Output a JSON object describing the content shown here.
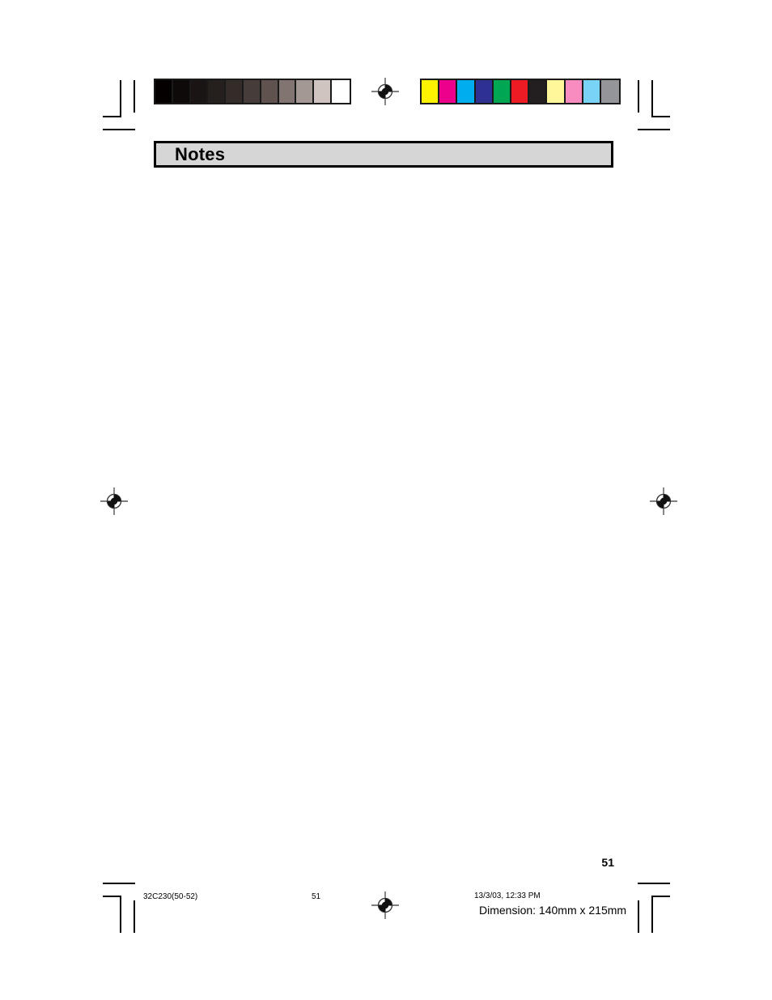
{
  "document": {
    "section_heading": "Notes",
    "page_number": "51"
  },
  "calibration": {
    "grayscale_label": "grayscale-calibration-strip",
    "grayscale_swatches": [
      {
        "name": "gray-step-0",
        "color": "#040000"
      },
      {
        "name": "gray-step-1",
        "color": "#0d0a09"
      },
      {
        "name": "gray-step-2",
        "color": "#1a1514"
      },
      {
        "name": "gray-step-3",
        "color": "#25201e"
      },
      {
        "name": "gray-step-4",
        "color": "#332c29"
      },
      {
        "name": "gray-step-5",
        "color": "#463c39"
      },
      {
        "name": "gray-step-6",
        "color": "#60534f"
      },
      {
        "name": "gray-step-7",
        "color": "#827470"
      },
      {
        "name": "gray-step-8",
        "color": "#a49894"
      },
      {
        "name": "gray-step-9",
        "color": "#cfc4c0"
      },
      {
        "name": "gray-step-10",
        "color": "#ffffff"
      }
    ],
    "color_label": "color-calibration-strip",
    "color_swatches": [
      {
        "name": "swatch-yellow",
        "color": "#fff200"
      },
      {
        "name": "swatch-magenta",
        "color": "#ec008c"
      },
      {
        "name": "swatch-cyan",
        "color": "#00aeef"
      },
      {
        "name": "swatch-blue",
        "color": "#2e3192"
      },
      {
        "name": "swatch-green",
        "color": "#00a651"
      },
      {
        "name": "swatch-red",
        "color": "#ed1c24"
      },
      {
        "name": "swatch-black",
        "color": "#231f20"
      },
      {
        "name": "swatch-pale-yellow",
        "color": "#fff79a"
      },
      {
        "name": "swatch-pink",
        "color": "#f88bc0"
      },
      {
        "name": "swatch-light-blue",
        "color": "#79d3f7"
      },
      {
        "name": "swatch-gray",
        "color": "#949599"
      }
    ]
  },
  "footer": {
    "job_name": "32C230(50-52)",
    "page_number": "51",
    "timestamp": "13/3/03, 12:33 PM",
    "dimension": "Dimension: 140mm x 215mm"
  },
  "marks": {
    "registration_icon": "registration-target-icon",
    "crop_mark": "crop-mark"
  }
}
